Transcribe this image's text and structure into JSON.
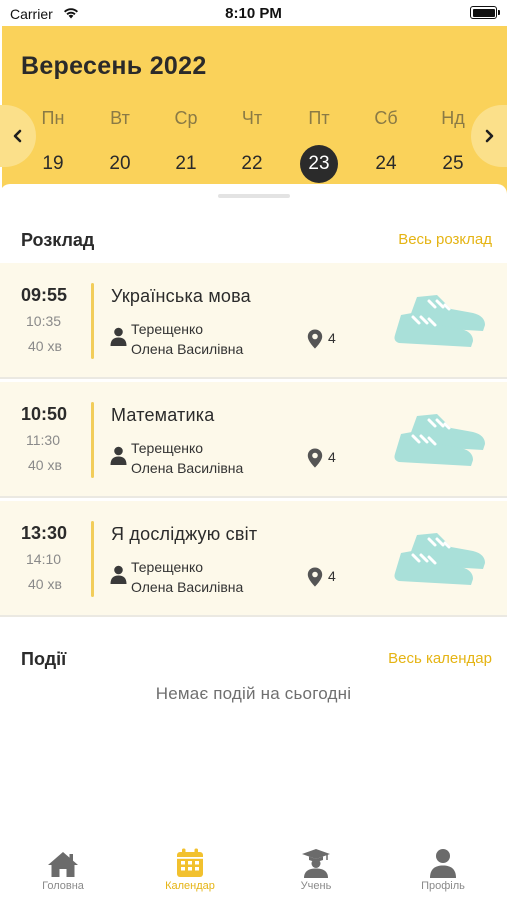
{
  "status_bar": {
    "carrier": "Carrier",
    "time": "8:10 PM"
  },
  "calendar": {
    "month_title": "Вересень 2022",
    "days": [
      {
        "name": "Пн",
        "num": "19"
      },
      {
        "name": "Вт",
        "num": "20"
      },
      {
        "name": "Ср",
        "num": "21"
      },
      {
        "name": "Чт",
        "num": "22"
      },
      {
        "name": "Пт",
        "num": "23"
      },
      {
        "name": "Сб",
        "num": "24"
      },
      {
        "name": "Нд",
        "num": "25"
      }
    ],
    "selected_index": 4
  },
  "schedule": {
    "title": "Розклад",
    "link": "Весь розклад",
    "lessons": [
      {
        "start": "09:55",
        "end": "10:35",
        "duration": "40 хв",
        "subject": "Українська мова",
        "teacher_surname": "Терещенко",
        "teacher_name": "Олена Василівна",
        "room": "4"
      },
      {
        "start": "10:50",
        "end": "11:30",
        "duration": "40 хв",
        "subject": "Математика",
        "teacher_surname": "Терещенко",
        "teacher_name": "Олена Василівна",
        "room": "4"
      },
      {
        "start": "13:30",
        "end": "14:10",
        "duration": "40 хв",
        "subject": "Я досліджую світ",
        "teacher_surname": "Терещенко",
        "teacher_name": "Олена Василівна",
        "room": "4"
      }
    ]
  },
  "events": {
    "title": "Події",
    "link": "Весь календар",
    "empty_text": "Немає подій на сьогодні"
  },
  "tabbar": {
    "items": [
      {
        "label": "Головна",
        "icon": "home-icon"
      },
      {
        "label": "Календар",
        "icon": "calendar-icon"
      },
      {
        "label": "Учень",
        "icon": "student-icon"
      },
      {
        "label": "Профіль",
        "icon": "profile-icon"
      }
    ],
    "active_index": 1
  },
  "colors": {
    "accent_yellow": "#fad25a",
    "link_yellow": "#e5b414",
    "selected_day": "#2b2b2b",
    "lesson_bg": "#fdf9ea",
    "shoe_teal": "#a9e0d9"
  }
}
